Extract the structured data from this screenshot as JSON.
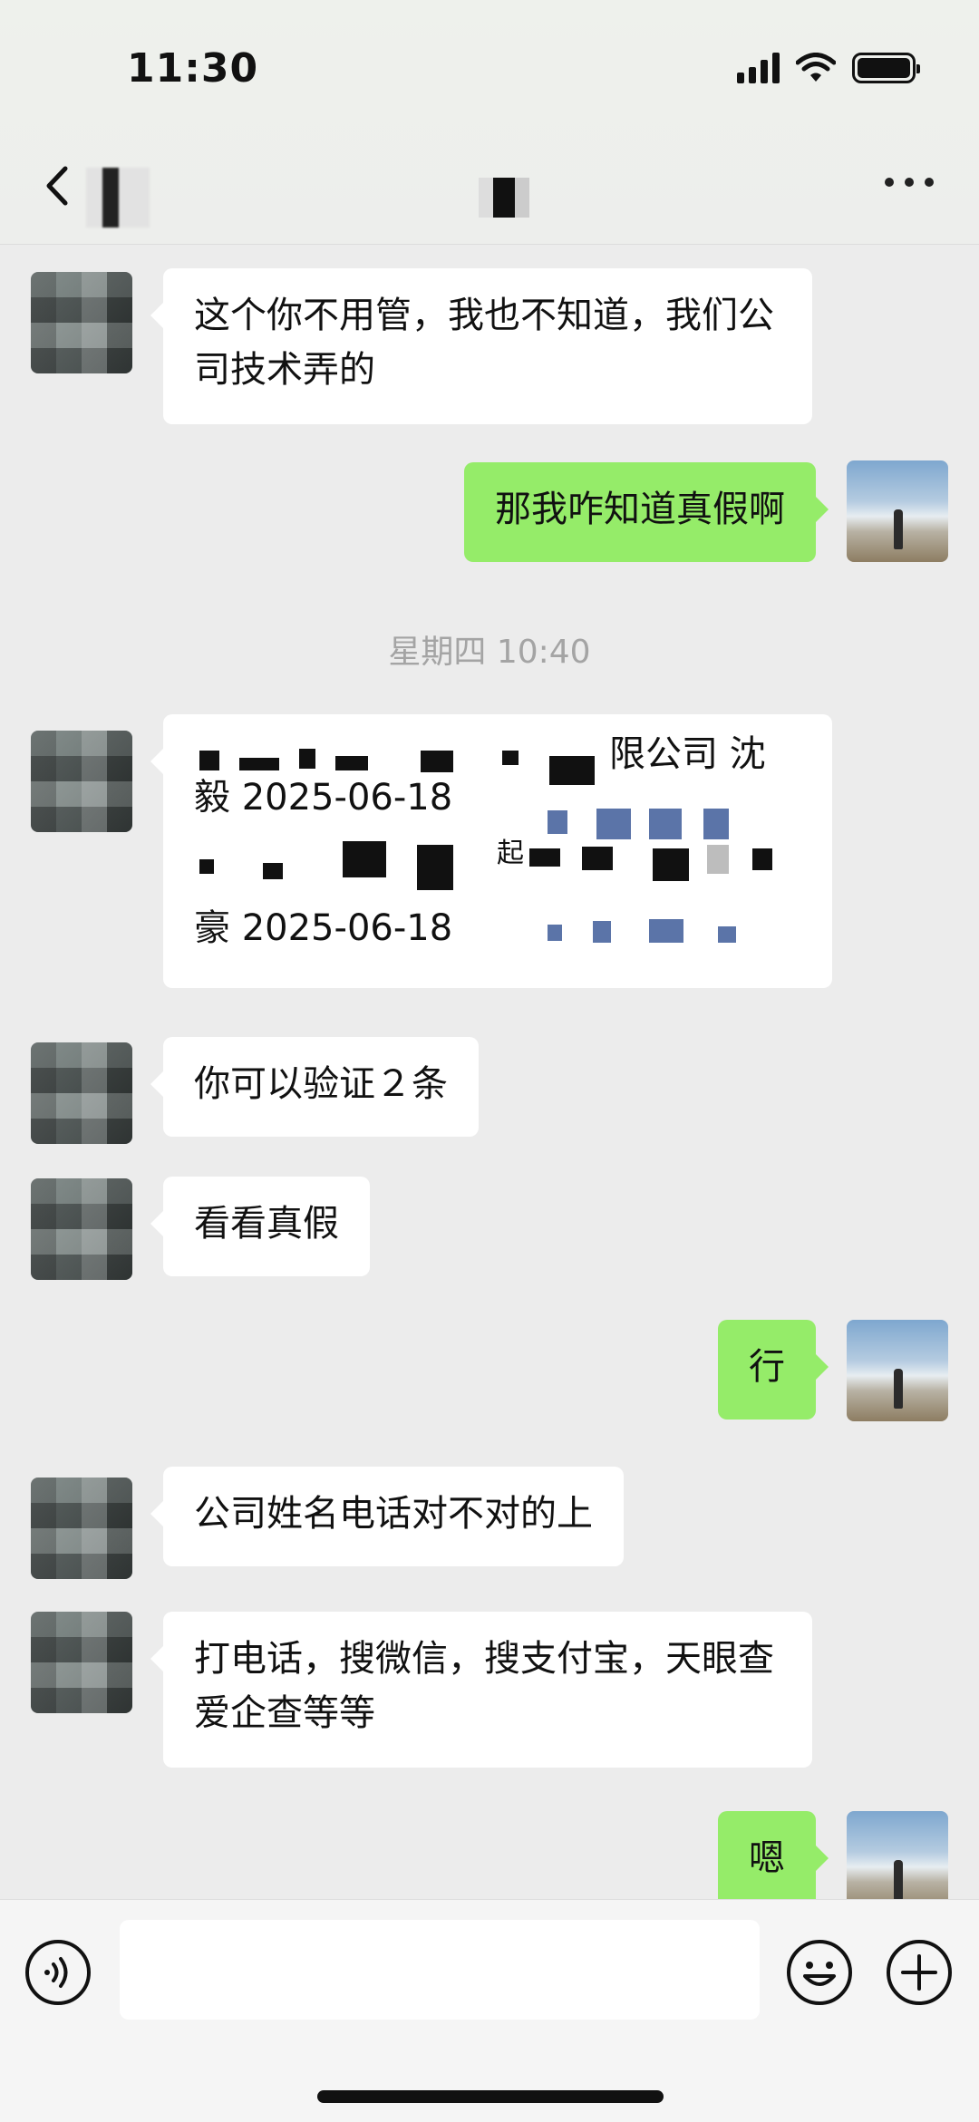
{
  "status_bar": {
    "time": "11:30"
  },
  "chat": {
    "time_separator": "星期四 10:40",
    "messages": {
      "m1": {
        "text": "这个你不用管，我也不知道，我们公司技术弄的"
      },
      "m2": {
        "text": "那我咋知道真假啊"
      },
      "m3": {
        "line1": "限公司  沈",
        "line2": "毅  2025-06-18",
        "line3": "起",
        "line4": "豪  2025-06-18"
      },
      "m4": {
        "text": "你可以验证２条"
      },
      "m5": {
        "text": "看看真假"
      },
      "m6": {
        "text": "行"
      },
      "m7": {
        "text": "公司姓名电话对不对的上"
      },
      "m8": {
        "text": "打电话，搜微信，搜支付宝，天眼查爱企查等等"
      },
      "m9": {
        "text": "嗯"
      }
    }
  },
  "colors": {
    "outgoing_bubble": "#95ec69",
    "incoming_bubble": "#ffffff",
    "chat_background": "#ececec"
  },
  "icons": [
    "back-icon",
    "more-icon",
    "voice-icon",
    "emoji-icon",
    "plus-icon",
    "signal-icon",
    "wifi-icon",
    "battery-icon"
  ]
}
